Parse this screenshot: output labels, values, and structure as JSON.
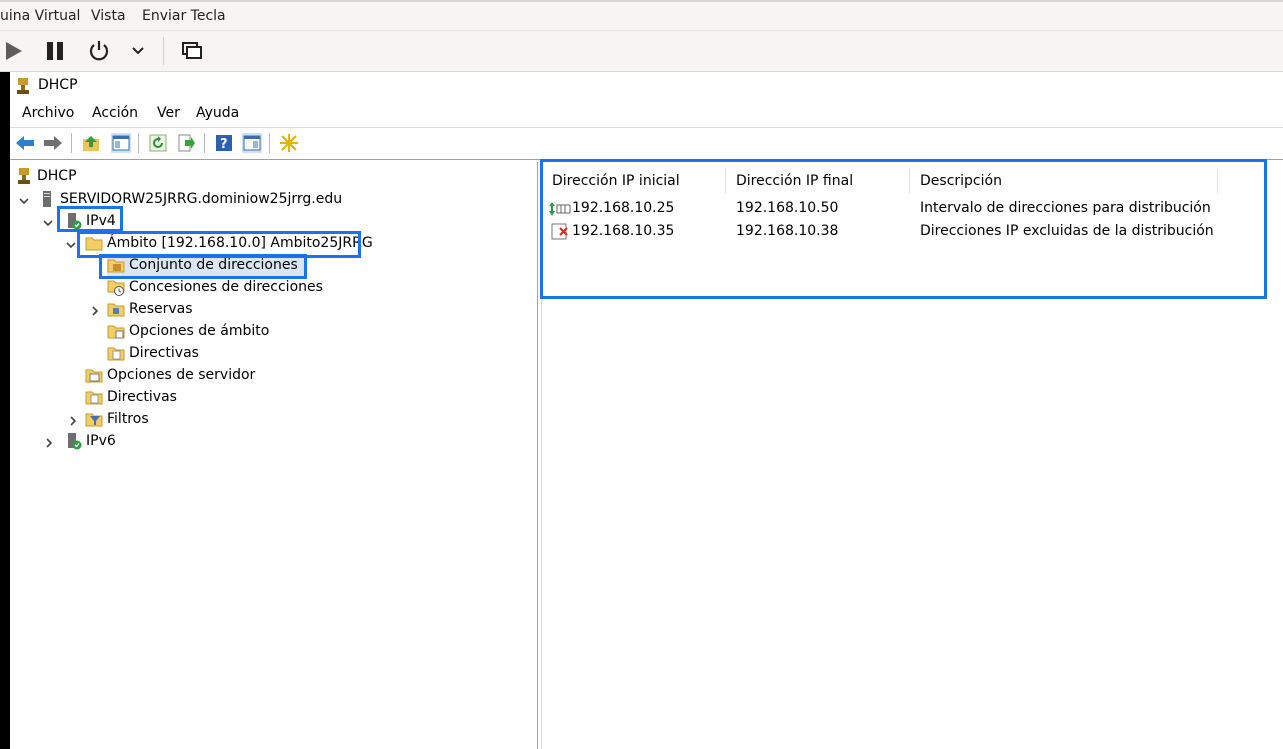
{
  "host": {
    "menu": [
      "uina Virtual",
      "Vista",
      "Enviar Tecla"
    ],
    "toolbar": [
      "play-icon",
      "pause-icon",
      "power-icon",
      "chevron-down-icon",
      "screens-icon"
    ]
  },
  "mmc": {
    "title": "DHCP",
    "menu": [
      "Archivo",
      "Acción",
      "Ver",
      "Ayuda"
    ]
  },
  "tree": {
    "root": "DHCP",
    "server": "SERVIDORW25JRRG.dominiow25jrrg.edu",
    "ipv4": "IPv4",
    "scope": "Ámbito [192.168.10.0] Ambito25JRRG",
    "pool": "Conjunto de direcciones",
    "leases": "Concesiones de direcciones",
    "reservations": "Reservas",
    "scope_options": "Opciones de ámbito",
    "scope_policies": "Directivas",
    "server_options": "Opciones de servidor",
    "policies": "Directivas",
    "filters": "Filtros",
    "ipv6": "IPv6"
  },
  "list": {
    "columns": [
      "Dirección IP inicial",
      "Dirección IP final",
      "Descripción"
    ],
    "rows": [
      {
        "start": "192.168.10.25",
        "end": "192.168.10.50",
        "desc": "Intervalo de direcciones para distribución"
      },
      {
        "start": "192.168.10.35",
        "end": "192.168.10.38",
        "desc": "Direcciones IP excluidas de la distribución"
      }
    ]
  },
  "colors": {
    "highlight": "#1a73e8",
    "selection": "#dbe6f4"
  }
}
